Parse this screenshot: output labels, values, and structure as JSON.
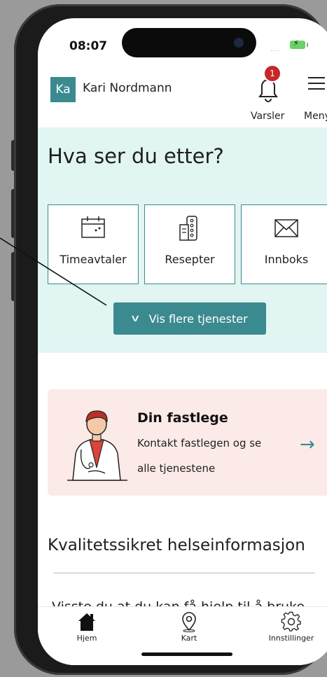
{
  "status_bar": {
    "time": "08:07",
    "signal": "....",
    "battery_icon": "battery-charging-icon"
  },
  "header": {
    "avatar_initials": "Ka",
    "user_name": "Kari Nordmann",
    "notifications": {
      "label": "Varsler",
      "count": "1",
      "icon": "bell-icon"
    },
    "menu": {
      "label": "Meny",
      "icon": "hamburger-icon"
    }
  },
  "hero": {
    "title": "Hva ser du etter?",
    "tiles": [
      {
        "label": "Timeavtaler",
        "icon": "calendar-icon"
      },
      {
        "label": "Resepter",
        "icon": "prescription-icon"
      },
      {
        "label": "Innboks",
        "icon": "envelope-icon"
      }
    ],
    "more_button": "Vis flere tjenester"
  },
  "fastlege_card": {
    "title": "Din fastlege",
    "subtitle_line1": "Kontakt fastlegen og se",
    "subtitle_line2": "alle tjenestene",
    "arrow": "→"
  },
  "info_section": {
    "title": "Kvalitetssikret helseinformasjon",
    "article_teaser": "Visste du at du kan få hjelp til å bruke"
  },
  "tab_bar": {
    "tabs": [
      {
        "label": "Hjem",
        "icon": "home-icon"
      },
      {
        "label": "Kart",
        "icon": "map-pin-icon"
      },
      {
        "label": "Innstillinger",
        "icon": "gear-icon"
      }
    ]
  },
  "colors": {
    "accent": "#3b8a8f",
    "hero_bg": "#e1f5f3",
    "card_bg": "#fbeae8",
    "badge": "#c62828"
  }
}
